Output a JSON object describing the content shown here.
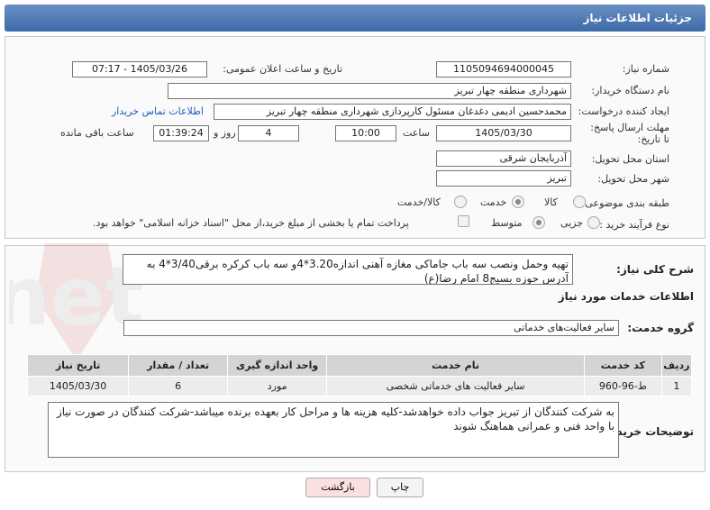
{
  "header": {
    "title": "جزئیات اطلاعات نیاز"
  },
  "fields": {
    "need_number_label": "شماره نیاز:",
    "need_number": "1105094694000045",
    "announce_label": "تاریخ و ساعت اعلان عمومی:",
    "announce_value": "1405/03/26 - 07:17",
    "buyer_label": "نام دستگاه خریدار:",
    "buyer_value": "شهرداری منطقه چهار تبریز",
    "creator_label": "ایجاد کننده درخواست:",
    "creator_value": "محمدحسین ادیمی دغدغان مسئول کارپردازی شهرداری منطقه چهار تبریز",
    "contact_link": "اطلاعات تماس خریدار",
    "deadline_label": "مهلت ارسال پاسخ: تا تاریخ:",
    "deadline_date": "1405/03/30",
    "time_label": "ساعت",
    "deadline_time": "10:00",
    "days_value": "4",
    "days_label": "روز و",
    "remaining_time": "01:39:24",
    "remaining_label": "ساعت باقی مانده",
    "province_label": "استان محل تحویل:",
    "province_value": "آذربایجان شرقی",
    "city_label": "شهر محل تحویل:",
    "city_value": "تبریز",
    "category_label": "طبقه بندی موضوعی:",
    "category_options": [
      "کالا",
      "خدمت",
      "کالا/خدمت"
    ],
    "process_label": "نوع فرآیند خرید :",
    "process_options": [
      "جزیی",
      "متوسط"
    ],
    "payment_text": "پرداخت تمام یا بخشی از مبلغ خرید،از محل \"اسناد خزانه اسلامی\" خواهد بود."
  },
  "summary": {
    "label": "شرح کلی نیاز:",
    "text": "تهیه وحمل ونصب سه باب جاماکی مغازه آهنی اندازه3.20*4و سه باب کرکره برقی3/40*4 به آدرس حوزه بسیج8 امام رضا(ع)"
  },
  "services": {
    "section_title": "اطلاعات خدمات مورد نیاز",
    "group_label": "گروه خدمت:",
    "group_value": "سایر فعالیت‌های خدماتی",
    "table": {
      "headers": [
        "ردیف",
        "کد خدمت",
        "نام خدمت",
        "واحد اندازه گیری",
        "تعداد / مقدار",
        "تاریخ نیاز"
      ],
      "rows": [
        [
          "1",
          "ط-96-960",
          "سایر فعالیت های خدماتی شخصی",
          "مورد",
          "6",
          "1405/03/30"
        ]
      ]
    }
  },
  "buyer_notes": {
    "label": "توضیحات خریدار:",
    "text": "به شرکت کنندگان از تبریز جواب داده خواهدشد-کلیه هزینه ها و مراحل کار بعهده برنده میباشد-شرکت کنندگان در صورت نیاز با واحد فنی و عمرانی هماهنگ شوند"
  },
  "buttons": {
    "print": "چاپ",
    "back": "بازگشت"
  },
  "watermark": {
    "text": "AriaTender.net"
  },
  "colors": {
    "header": "#3d6aa8",
    "link": "#1b5fc1",
    "back_button": "#fbe0e0"
  }
}
